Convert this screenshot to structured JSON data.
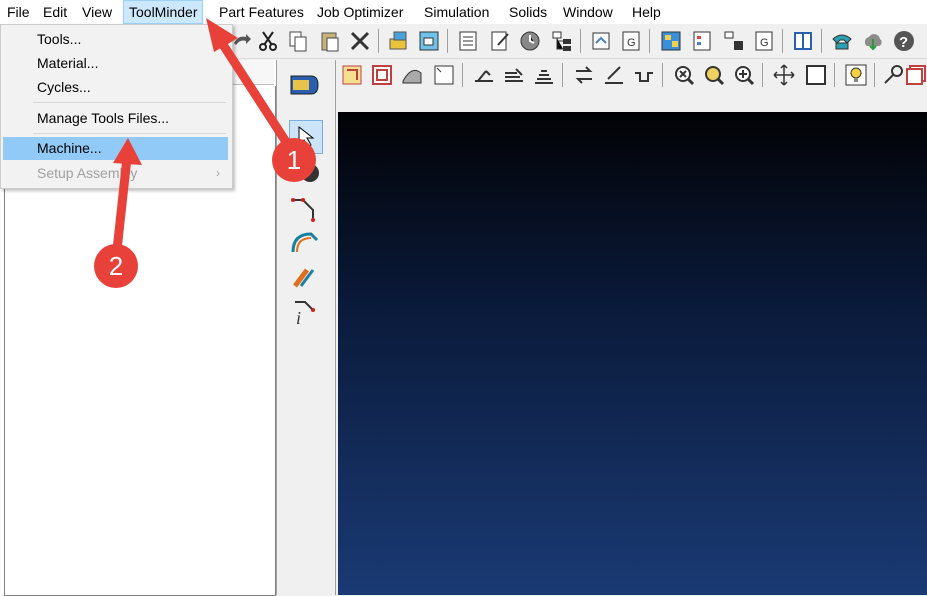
{
  "menubar": {
    "items": [
      "File",
      "Edit",
      "View",
      "ToolMinder",
      "Part Features",
      "Job Optimizer",
      "Simulation",
      "Solids",
      "Window",
      "Help"
    ],
    "active_index": 3
  },
  "dropdown": {
    "items": [
      {
        "label": "Tools...",
        "state": "normal"
      },
      {
        "label": "Material...",
        "state": "normal"
      },
      {
        "label": "Cycles...",
        "state": "normal"
      },
      {
        "label": "Manage Tools Files...",
        "state": "normal"
      },
      {
        "label": "Machine...",
        "state": "highlighted"
      },
      {
        "label": "Setup Assembly",
        "state": "disabled",
        "submenu": true
      }
    ],
    "submenu_arrow": "›"
  },
  "annotations": {
    "step1": "1",
    "step2": "2",
    "arrow_color": "#e8413a"
  },
  "viewport": {
    "gradient_top": "#020205",
    "gradient_bottom": "#1a3a74"
  }
}
